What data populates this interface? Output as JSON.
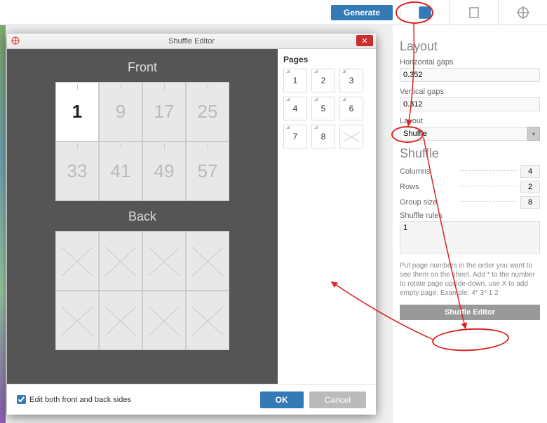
{
  "topbar": {
    "generate_label": "Generate"
  },
  "panel": {
    "layout_section": "Layout",
    "horizontal_gaps_label": "Horizontal gaps",
    "horizontal_gaps_value": "0.352",
    "vertical_gaps_label": "Vertical gaps",
    "vertical_gaps_value": "0.312",
    "layout_label": "Layout",
    "layout_value": "Shuffle",
    "shuffle_section": "Shuffle",
    "columns_label": "Columns",
    "columns_value": "4",
    "rows_label": "Rows",
    "rows_value": "2",
    "group_size_label": "Group size",
    "group_size_value": "8",
    "shuffle_rules_label": "Shuffle rules",
    "shuffle_rules_value": "1",
    "help_text": "Put page numbers in the order you want to see them on the sheet. Add * to the number to rotate page upside-down, use X to add empty page. Example: 4* 3* 1 2",
    "shuffle_editor_btn": "Shuffle Editor"
  },
  "dialog": {
    "title": "Shuffle Editor",
    "pages_title": "Pages",
    "pages": [
      "1",
      "2",
      "3",
      "4",
      "5",
      "6",
      "7",
      "8",
      ""
    ],
    "front_label": "Front",
    "back_label": "Back",
    "front_cells": [
      "1",
      "9",
      "17",
      "25",
      "33",
      "41",
      "49",
      "57"
    ],
    "checkbox_label": "Edit both front and back sides",
    "ok_label": "OK",
    "cancel_label": "Cancel"
  }
}
